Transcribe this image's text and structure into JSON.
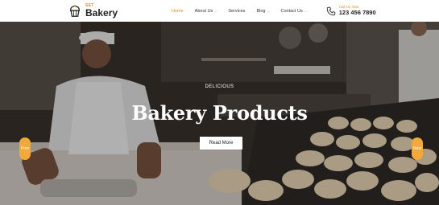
{
  "header": {
    "logo": {
      "small": "SET",
      "name": "Bakery"
    },
    "nav": [
      {
        "label": "Home",
        "active": true,
        "dropdown": false
      },
      {
        "label": "About Us",
        "active": false,
        "dropdown": true
      },
      {
        "label": "Services",
        "active": false,
        "dropdown": false
      },
      {
        "label": "Blog",
        "active": false,
        "dropdown": true
      },
      {
        "label": "Contact Us",
        "active": false,
        "dropdown": true
      }
    ],
    "call": {
      "label": "Call Us Now",
      "number": "123 456 7890"
    }
  },
  "hero": {
    "eyebrow": "DELICIOUS",
    "title": "Bakery Products",
    "cta_label": "Read More",
    "prev_label": "Prev",
    "next_label": "Next"
  },
  "colors": {
    "accent": "#e58a1f",
    "arrow": "#f2a93b"
  },
  "icons": {
    "logo": "cupcake-icon",
    "phone": "phone-icon",
    "chevron": "chevron-down-icon"
  }
}
